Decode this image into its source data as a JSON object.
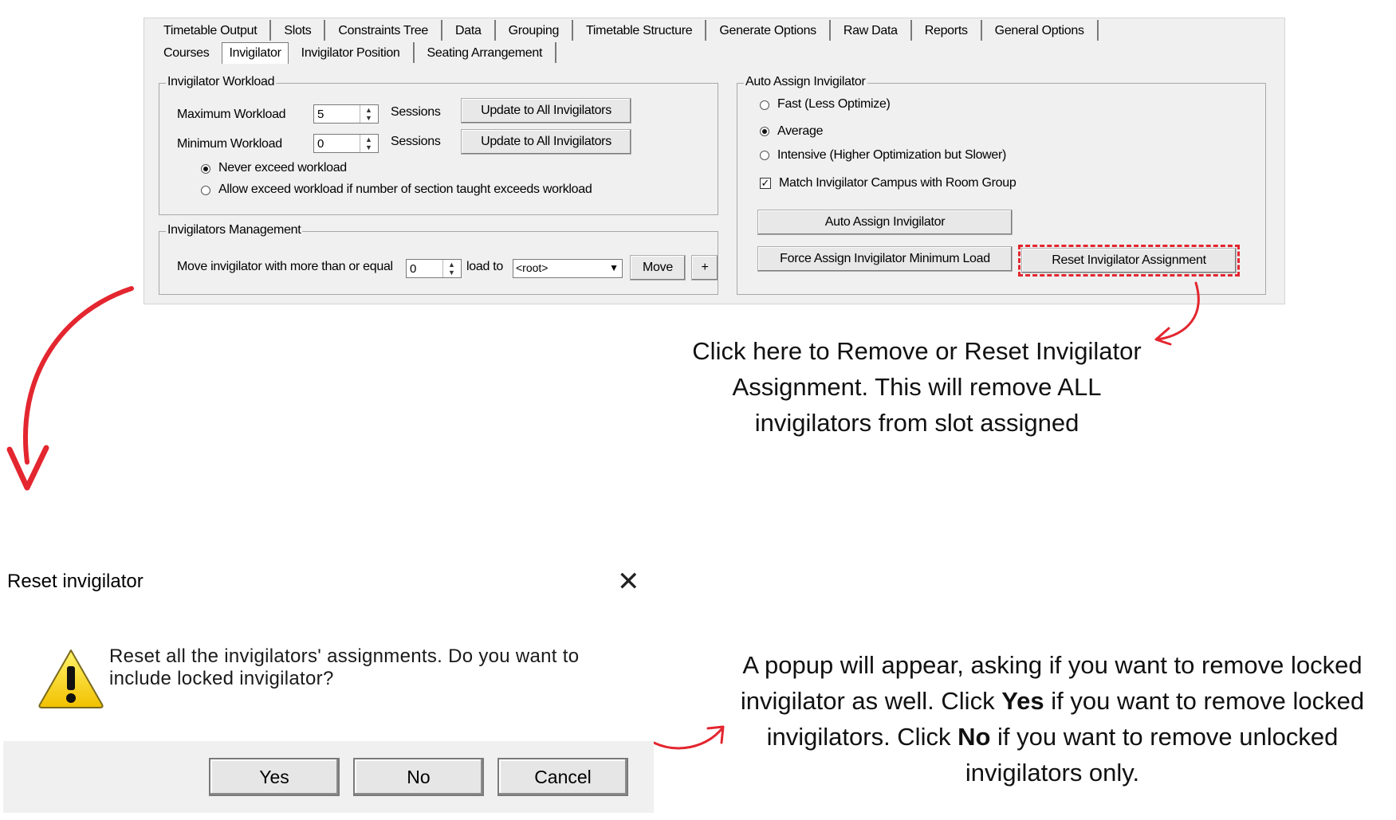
{
  "panel": {
    "tabs": [
      "Timetable Output",
      "Slots",
      "Constraints Tree",
      "Data",
      "Grouping",
      "Timetable Structure",
      "Generate Options",
      "Raw Data",
      "Reports",
      "General Options"
    ],
    "subtabs": [
      "Courses",
      "Invigilator",
      "Invigilator Position",
      "Seating Arrangement"
    ],
    "workload": {
      "title": "Invigilator Workload",
      "max_label": "Maximum Workload",
      "max_value": "5",
      "min_label": "Minimum Workload",
      "min_value": "0",
      "sessions_label": "Sessions",
      "update_button": "Update to All Invigilators",
      "radio_never": "Never exceed workload",
      "radio_allow": "Allow exceed workload if number of section taught exceeds workload"
    },
    "management": {
      "title": "Invigilators Management",
      "move_label": "Move invigilator with more than or equal",
      "move_value": "0",
      "load_to_label": "load to",
      "combo_value": "<root>",
      "move_button": "Move",
      "plus_button": "+"
    },
    "auto": {
      "title": "Auto Assign Invigilator",
      "fast": "Fast (Less Optimize)",
      "average": "Average",
      "intensive": "Intensive (Higher Optimization but Slower)",
      "match": "Match Invigilator Campus with Room Group",
      "auto_button": "Auto Assign Invigilator",
      "force_button": "Force Assign Invigilator Minimum Load",
      "reset_button": "Reset Invigilator Assignment"
    }
  },
  "annotations": {
    "note1": "Click here to Remove or Reset Invigilator Assignment. This will remove ALL invigilators from slot assigned",
    "note2_a": "A popup will appear, asking if you want to remove locked invigilator as well. Click ",
    "note2_yes": "Yes",
    "note2_b": " if you want to remove locked invigilators. Click ",
    "note2_no": "No",
    "note2_c": " if you want to remove unlocked invigilators only."
  },
  "dialog": {
    "title": "Reset invigilator",
    "message": "Reset all the invigilators' assignments. Do you want to include locked invigilator?",
    "yes": "Yes",
    "no": "No",
    "cancel": "Cancel"
  },
  "colors": {
    "highlight_red": "#e3262f",
    "panel_bg": "#f0f0f0",
    "dialog_footer": "#f0f0f0"
  }
}
